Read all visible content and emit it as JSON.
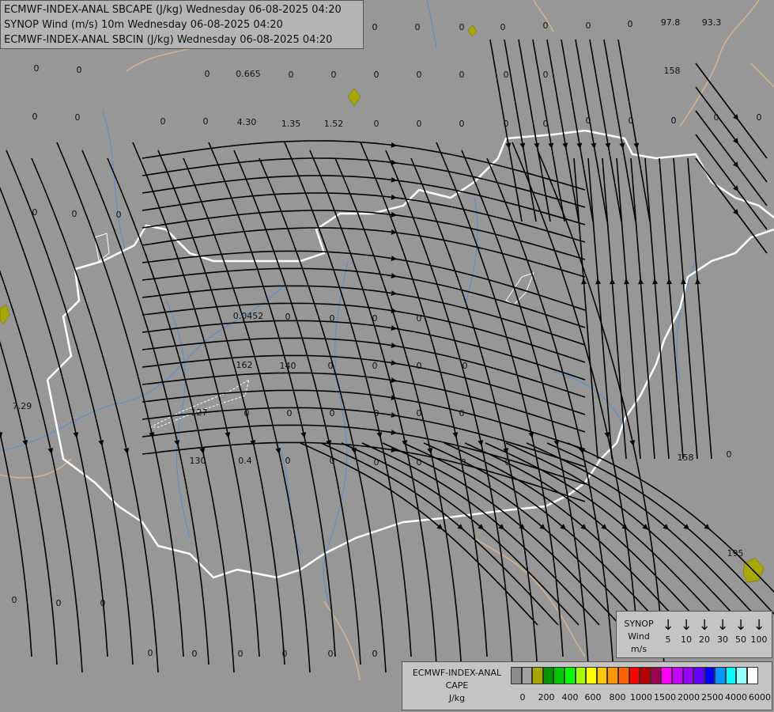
{
  "title": {
    "line1": "ECMWF-INDEX-ANAL SBCAPE (J/kg) Wednesday 06-08-2025 04:20",
    "line2": "SYNOP Wind (m/s) 10m Wednesday 06-08-2025 04:20",
    "line3": "ECMWF-INDEX-ANAL SBCIN (J/kg) Wednesday 06-08-2025 04:20"
  },
  "colors": {
    "background": "#979797",
    "border_national": "#ffffff",
    "border_regional": "#d9b48a",
    "rivers": "#4f8fd8",
    "streamlines": "#000000",
    "cape_low": "#a8a800"
  },
  "map_values": [
    "97.8",
    "93.3",
    "0",
    "0",
    "0",
    "0",
    "0",
    "0",
    "0",
    "0",
    "0",
    "0",
    "0.665",
    "0",
    "0",
    "0",
    "0",
    "0",
    "0",
    "0",
    "158",
    "0",
    "0",
    "0",
    "0",
    "4.30",
    "1.35",
    "1.52",
    "0",
    "0",
    "0",
    "0",
    "0",
    "0",
    "0",
    "0",
    "0",
    "0",
    "0",
    "0",
    "0",
    "0.0452",
    "0",
    "0",
    "0",
    "0",
    "162",
    "140",
    "0",
    "0",
    "0",
    "0",
    "7.29",
    "127",
    "0",
    "0",
    "0",
    "0",
    "0",
    "0",
    "130",
    "0.4",
    "0",
    "0",
    "0",
    "0",
    "0",
    "0",
    "158",
    "0",
    "195",
    "0",
    "0",
    "0",
    "0",
    "0",
    "0",
    "0",
    "0",
    "0"
  ],
  "synop_legend": {
    "title_line1": "SYNOP",
    "title_line2": "Wind",
    "title_line3": "m/s",
    "arrow": "↓",
    "speeds": [
      "5",
      "10",
      "20",
      "30",
      "50",
      "100"
    ]
  },
  "cape_legend": {
    "title_line1": "ECMWF-INDEX-ANAL",
    "title_line2": "CAPE",
    "title_line3": "J/kg",
    "swatch_colors": [
      "#8c8c8c",
      "#a0a0a0",
      "#a8a800",
      "#009600",
      "#00c800",
      "#00ff00",
      "#a8ff00",
      "#ffff00",
      "#ffc800",
      "#ff9600",
      "#ff6400",
      "#ff0000",
      "#b40000",
      "#a00050",
      "#ff00ff",
      "#c800ff",
      "#9600ff",
      "#6400ff",
      "#0000ff",
      "#0096ff",
      "#00ffff",
      "#96ffff",
      "#ffffff"
    ],
    "tick_labels": [
      "0",
      "200",
      "400",
      "600",
      "800",
      "1000",
      "1500",
      "2000",
      "2500",
      "4000",
      "6000"
    ]
  }
}
